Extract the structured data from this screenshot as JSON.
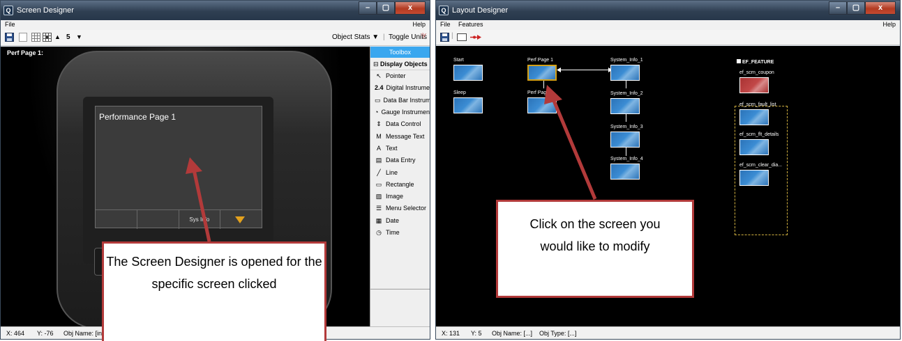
{
  "screen_designer": {
    "title": "Screen Designer",
    "menu": {
      "file": "File",
      "help": "Help"
    },
    "toolbar": {
      "step_value": "5",
      "object_stats": "Object Stats",
      "toggle_units": "Toggle Units"
    },
    "canvas_label": "Perf Page 1:",
    "lcd": {
      "title": "Performance Page 1",
      "buttons": [
        "",
        "",
        "Sys Info",
        ""
      ]
    },
    "toolbox": {
      "header": "Toolbox",
      "section": "Display Objects",
      "items": [
        {
          "label": "Pointer",
          "icon": "pointer-icon",
          "glyph": "↖"
        },
        {
          "label": "Digital Instrument",
          "icon": "digital-instrument-icon",
          "glyph": "2.4"
        },
        {
          "label": "Data Bar Instrument",
          "icon": "data-bar-icon",
          "glyph": "▭"
        },
        {
          "label": "Gauge Instrument",
          "icon": "gauge-icon",
          "glyph": "◔"
        },
        {
          "label": "Data Control",
          "icon": "data-control-icon",
          "glyph": "⇕"
        },
        {
          "label": "Message Text",
          "icon": "message-text-icon",
          "glyph": "M"
        },
        {
          "label": "Text",
          "icon": "text-icon",
          "glyph": "A"
        },
        {
          "label": "Data Entry",
          "icon": "data-entry-icon",
          "glyph": "▤"
        },
        {
          "label": "Line",
          "icon": "line-icon",
          "glyph": "╱"
        },
        {
          "label": "Rectangle",
          "icon": "rectangle-icon",
          "glyph": "▭"
        },
        {
          "label": "Image",
          "icon": "image-icon",
          "glyph": "▨"
        },
        {
          "label": "Menu Selector",
          "icon": "menu-selector-icon",
          "glyph": "☰"
        },
        {
          "label": "Date",
          "icon": "date-icon",
          "glyph": "▦"
        },
        {
          "label": "Time",
          "icon": "time-icon",
          "glyph": "◷"
        }
      ]
    },
    "status": {
      "x": "X: 464",
      "y": "Y: -76",
      "obj_name": "Obj Name: [in"
    }
  },
  "layout_designer": {
    "title": "Layout Designer",
    "menu": {
      "file": "File",
      "features": "Features",
      "help": "Help"
    },
    "screens": {
      "start": "Start",
      "sleep": "Sleep",
      "perf1": "Perf Page 1",
      "perf2": "Perf Page 2",
      "sys1": "System_Info_1",
      "sys2": "System_Info_2",
      "sys3": "System_Info_3",
      "sys4": "System_Info_4"
    },
    "feature_group": {
      "title": "EF_FEATURE",
      "items": [
        "ef_scrn_coupon",
        "ef_scrn_fault_list",
        "ef_scrn_flt_details",
        "ef_scrn_clear_dia..."
      ]
    },
    "status": {
      "x": "X: 131",
      "y": "Y: 5",
      "obj_name": "Obj Name: [...]",
      "obj_type": "Obj Type: [...]"
    }
  },
  "callouts": {
    "left": "The Screen Designer is opened for the specific screen clicked",
    "right": "Click on the screen you would like to modify"
  },
  "colors": {
    "arrow": "#b23a3a",
    "toolbox_header": "#3aa7ef",
    "selected_screen": "#d4a017"
  }
}
